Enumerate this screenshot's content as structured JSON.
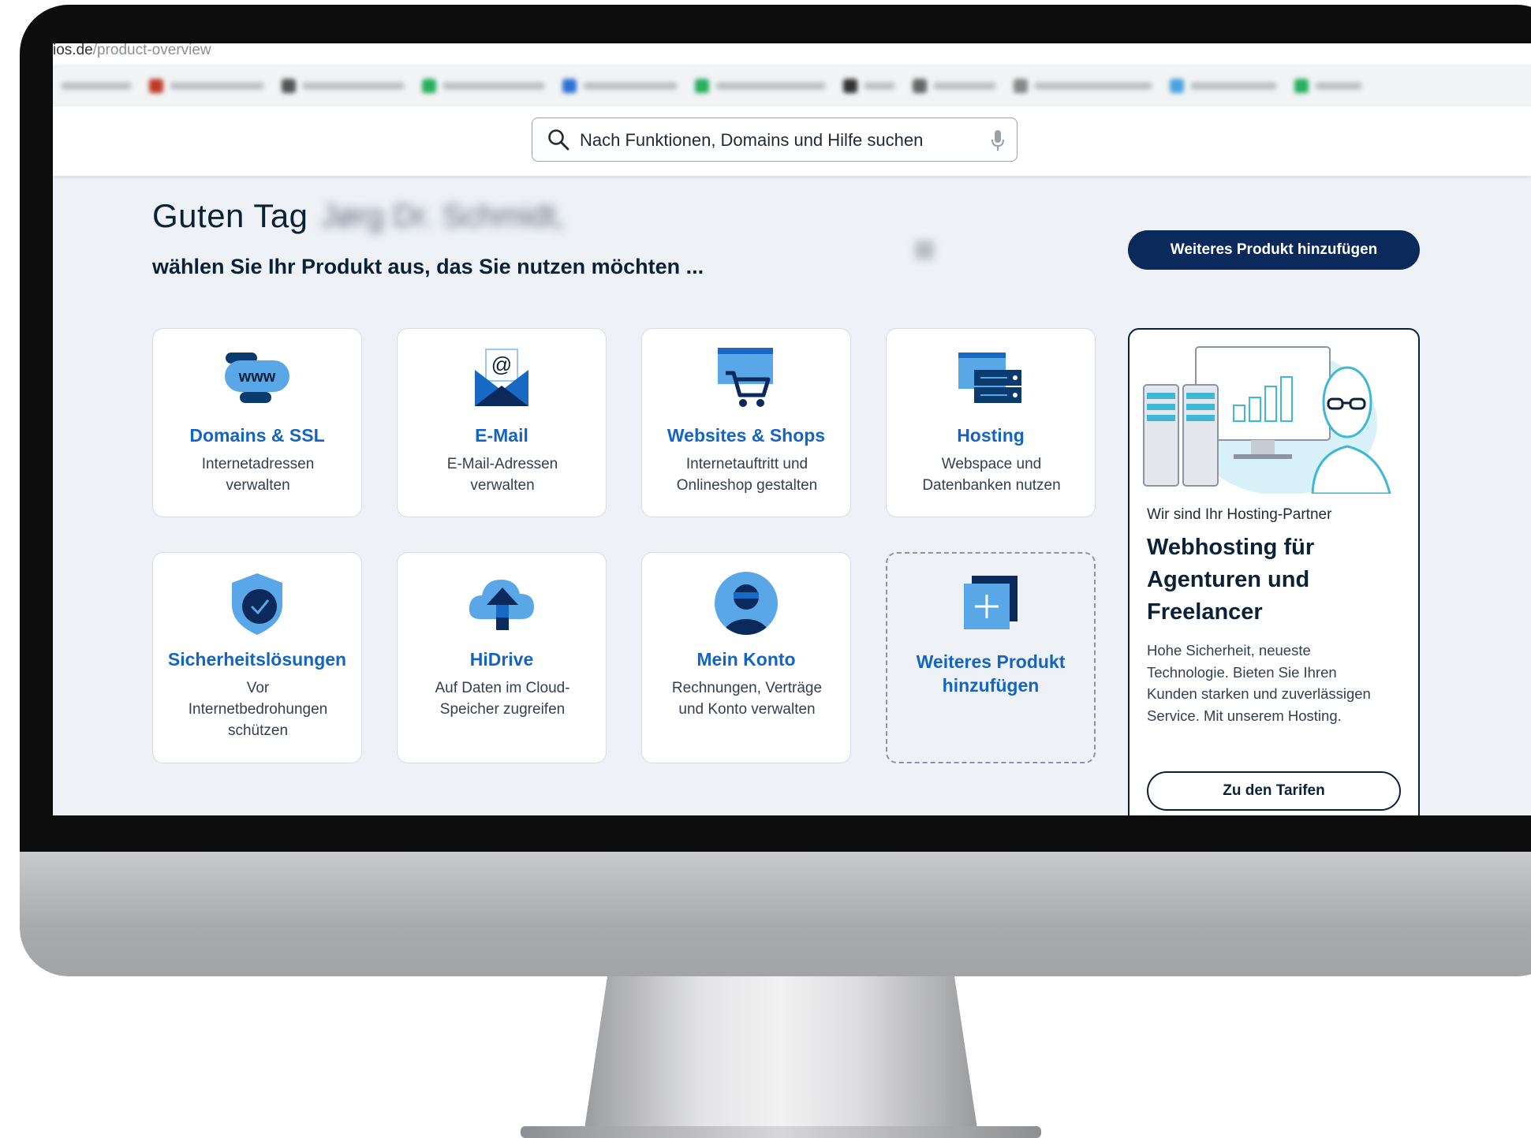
{
  "browser": {
    "url_host": "ios.de",
    "url_path": "/product-overview"
  },
  "search": {
    "placeholder": "Nach Funktionen, Domains und Hilfe suchen"
  },
  "greeting": {
    "hello": "Guten Tag",
    "name": "Jørg Dr. Schmidt,",
    "subtitle": "wählen Sie Ihr Produkt aus, das Sie nutzen möchten ..."
  },
  "actions": {
    "add_product": "Weiteres Produkt hinzufügen"
  },
  "cards": [
    {
      "title": "Domains & SSL",
      "desc_1": "Internetadressen",
      "desc_2": "verwalten",
      "icon": "www-domain-icon"
    },
    {
      "title": "E-Mail",
      "desc_1": "E-Mail-Adressen",
      "desc_2": "verwalten",
      "icon": "email-envelope-icon"
    },
    {
      "title": "Websites & Shops",
      "desc_1": "Internetauftritt und",
      "desc_2": "Onlineshop gestalten",
      "icon": "website-shop-cart-icon"
    },
    {
      "title": "Hosting",
      "desc_1": "Webspace und",
      "desc_2": "Datenbanken nutzen",
      "icon": "hosting-server-icon"
    },
    {
      "title": "Sicherheitslösungen",
      "desc_1": "Vor",
      "desc_2": "Internetbedrohungen",
      "desc_3": "schützen",
      "icon": "security-shield-icon"
    },
    {
      "title": "HiDrive",
      "desc_1": "Auf Daten im Cloud-",
      "desc_2": "Speicher zugreifen",
      "icon": "cloud-upload-icon"
    },
    {
      "title": "Mein Konto",
      "desc_1": "Rechnungen, Verträge",
      "desc_2": "und Konto verwalten",
      "icon": "user-account-icon"
    },
    {
      "title_1": "Weiteres Produkt",
      "title_2": "hinzufügen",
      "icon": "add-product-icon"
    }
  ],
  "promo": {
    "eyebrow": "Wir sind Ihr Hosting-Partner",
    "title_1": "Webhosting für",
    "title_2": "Agenturen und",
    "title_3": "Freelancer",
    "text_1": "Hohe Sicherheit, neueste",
    "text_2": "Technologie. Bieten Sie Ihren",
    "text_3": "Kunden starken und zuverlässigen",
    "text_4": "Service. Mit unserem Hosting.",
    "cta": "Zu den Tarifen"
  },
  "colors": {
    "brand_navy": "#0b2a5b",
    "link_blue": "#1565c0",
    "page_bg": "#eef2f7"
  }
}
